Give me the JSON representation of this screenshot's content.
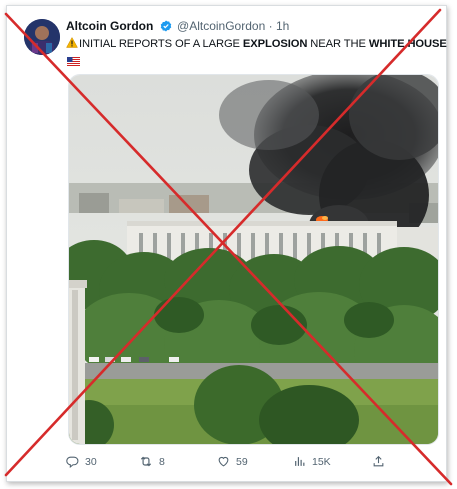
{
  "tweet": {
    "author_name": "Altcoin Gordon",
    "handle": "@AltcoinGordon",
    "separator": "·",
    "time": "1h",
    "text_parts": [
      "INITIAL REPORTS OF A LARGE ",
      "EXPLOSION",
      " NEAR THE ",
      "WHITE HOUSE"
    ],
    "flag_emoji": "us-flag"
  },
  "actions": {
    "replies": "30",
    "retweets": "8",
    "likes": "59",
    "views": "15K"
  },
  "icons": {
    "verified": "verified-badge-icon",
    "warning": "warning-icon",
    "reply": "reply-icon",
    "retweet": "retweet-icon",
    "like": "heart-icon",
    "views": "views-icon",
    "share": "share-icon"
  },
  "colors": {
    "verified": "#1d9bf0",
    "x_overlay": "#d62b2b",
    "text": "#0f1419",
    "muted": "#536471"
  }
}
